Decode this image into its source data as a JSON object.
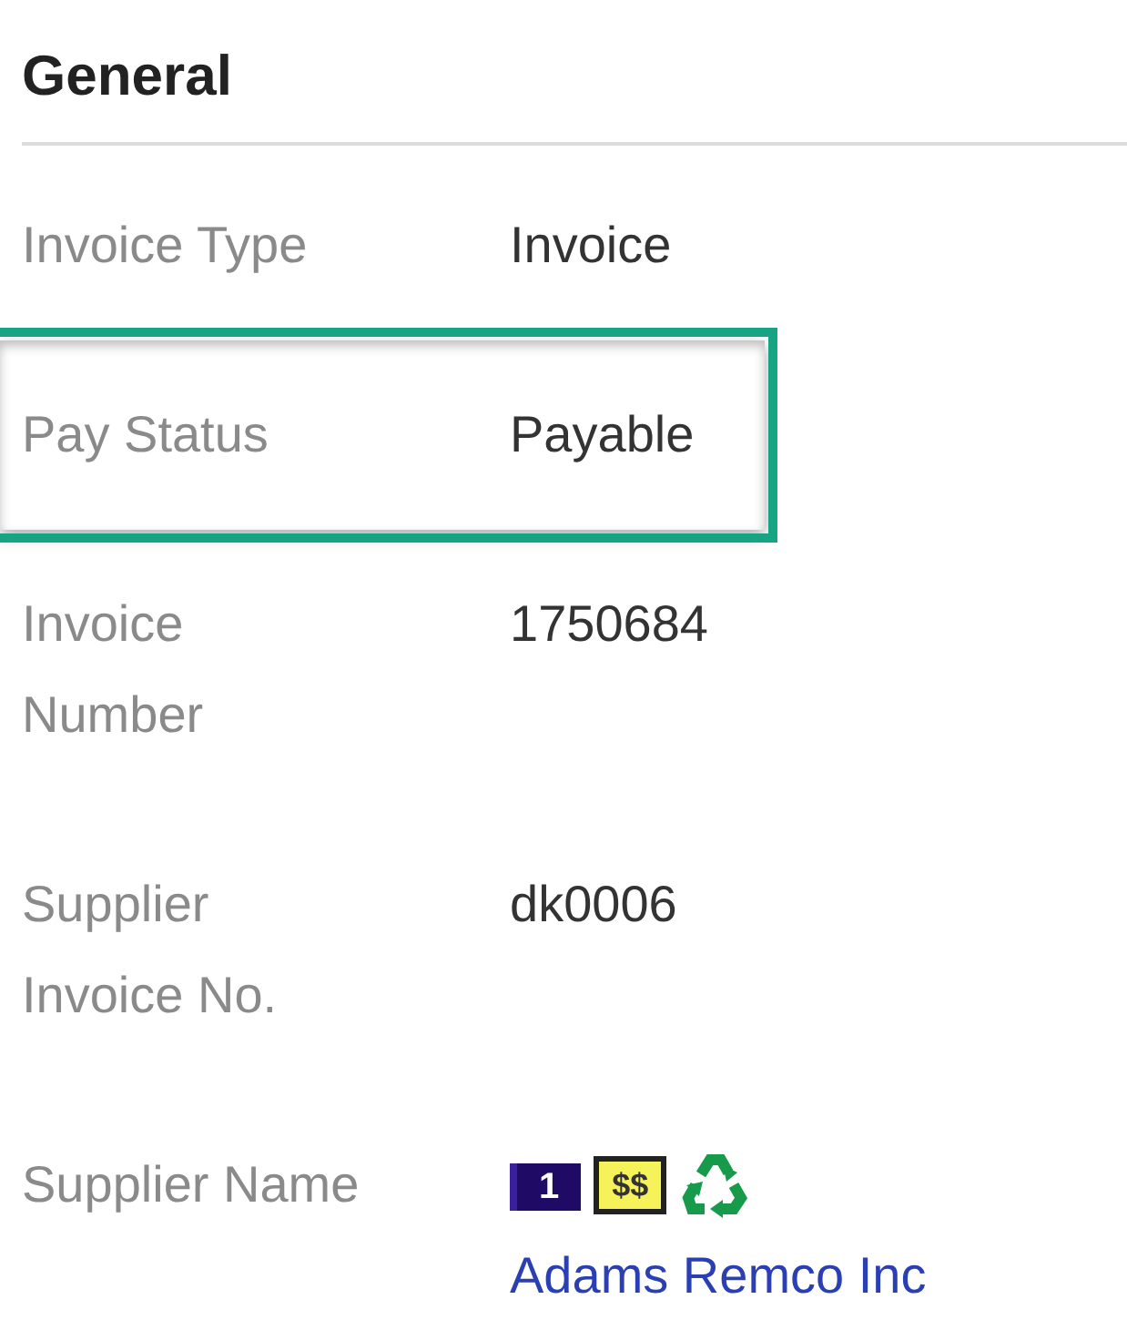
{
  "section": {
    "title": "General"
  },
  "fields": [
    {
      "kind": "text",
      "label": "Invoice Type",
      "value": "Invoice",
      "highlighted": false
    },
    {
      "kind": "text",
      "label": "Pay Status",
      "value": "Payable",
      "highlighted": true
    },
    {
      "kind": "text",
      "label": "Invoice Number",
      "value": "1750684",
      "highlighted": false
    },
    {
      "kind": "text",
      "label": "Supplier Invoice No.",
      "value": "dk0006",
      "highlighted": false
    },
    {
      "kind": "supplier",
      "label": "Supplier Name",
      "highlighted": false,
      "badges": [
        {
          "kind": "flag",
          "text": "1"
        },
        {
          "kind": "price",
          "text": "$$"
        },
        {
          "kind": "recycle"
        }
      ],
      "link": "Adams Remco Inc"
    }
  ]
}
